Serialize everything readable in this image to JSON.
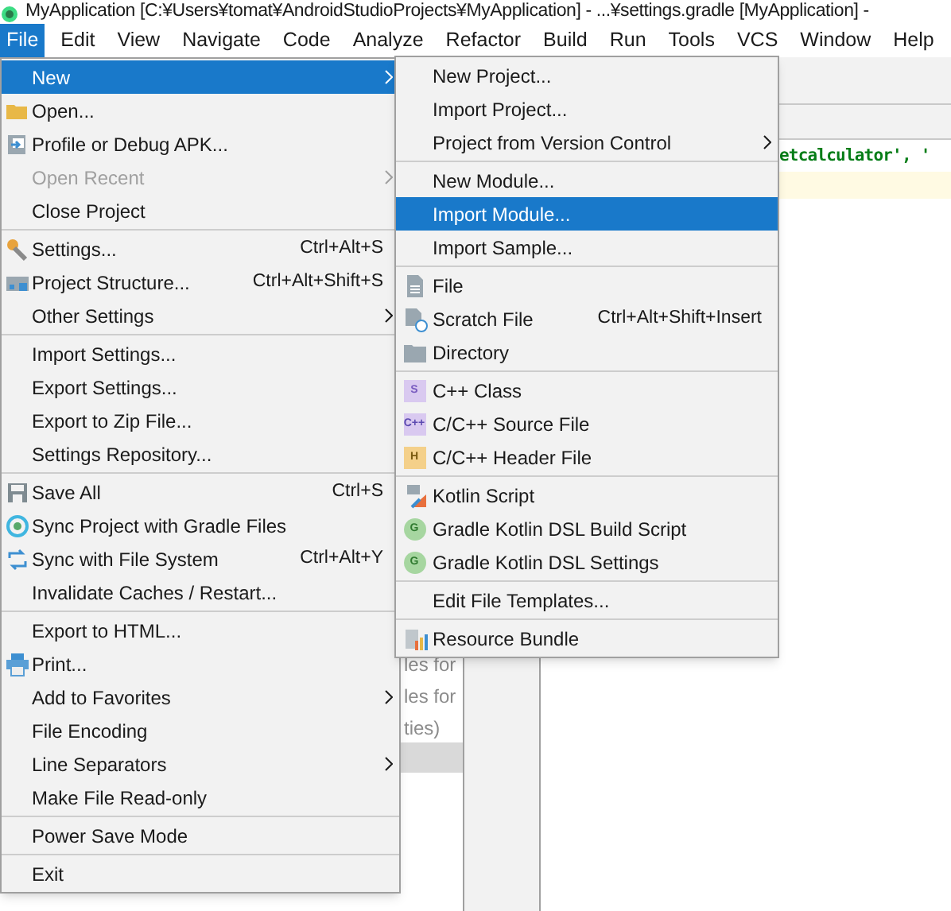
{
  "window": {
    "title": "MyApplication [C:¥Users¥tomat¥AndroidStudioProjects¥MyApplication] - ...¥settings.gradle [MyApplication] -"
  },
  "menu_bar": [
    {
      "label": "File",
      "selected": true
    },
    {
      "label": "Edit",
      "selected": false
    },
    {
      "label": "View",
      "selected": false
    },
    {
      "label": "Navigate",
      "selected": false
    },
    {
      "label": "Code",
      "selected": false
    },
    {
      "label": "Analyze",
      "selected": false
    },
    {
      "label": "Refactor",
      "selected": false
    },
    {
      "label": "Build",
      "selected": false
    },
    {
      "label": "Run",
      "selected": false
    },
    {
      "label": "Tools",
      "selected": false
    },
    {
      "label": "VCS",
      "selected": false
    },
    {
      "label": "Window",
      "selected": false
    },
    {
      "label": "Help",
      "selected": false
    }
  ],
  "editor": {
    "code_line": "etcalculator', '",
    "behind_lines": [
      "les for",
      "les for",
      "ties)"
    ]
  },
  "file_menu": {
    "items": [
      {
        "kind": "item",
        "label": "New",
        "selected": true,
        "disabled": false,
        "submenu": true
      },
      {
        "kind": "item",
        "label": "Open...",
        "selected": false,
        "disabled": false,
        "submenu": false
      },
      {
        "kind": "item",
        "label": "Profile or Debug APK...",
        "selected": false,
        "disabled": false,
        "submenu": false
      },
      {
        "kind": "item",
        "label": "Open Recent",
        "selected": false,
        "disabled": true,
        "submenu": true
      },
      {
        "kind": "item",
        "label": "Close Project",
        "selected": false,
        "disabled": false,
        "submenu": false
      },
      {
        "kind": "separator"
      },
      {
        "kind": "item",
        "label": "Settings...",
        "shortcut": "Ctrl+Alt+S",
        "selected": false,
        "disabled": false,
        "submenu": false
      },
      {
        "kind": "item",
        "label": "Project Structure...",
        "shortcut": "Ctrl+Alt+Shift+S",
        "selected": false,
        "disabled": false,
        "submenu": false
      },
      {
        "kind": "item",
        "label": "Other Settings",
        "selected": false,
        "disabled": false,
        "submenu": true
      },
      {
        "kind": "separator"
      },
      {
        "kind": "item",
        "label": "Import Settings...",
        "selected": false,
        "disabled": false,
        "submenu": false
      },
      {
        "kind": "item",
        "label": "Export Settings...",
        "selected": false,
        "disabled": false,
        "submenu": false
      },
      {
        "kind": "item",
        "label": "Export to Zip File...",
        "selected": false,
        "disabled": false,
        "submenu": false
      },
      {
        "kind": "item",
        "label": "Settings Repository...",
        "selected": false,
        "disabled": false,
        "submenu": false
      },
      {
        "kind": "separator"
      },
      {
        "kind": "item",
        "label": "Save All",
        "shortcut": "Ctrl+S",
        "selected": false,
        "disabled": false,
        "submenu": false
      },
      {
        "kind": "item",
        "label": "Sync Project with Gradle Files",
        "selected": false,
        "disabled": false,
        "submenu": false
      },
      {
        "kind": "item",
        "label": "Sync with File System",
        "shortcut": "Ctrl+Alt+Y",
        "selected": false,
        "disabled": false,
        "submenu": false
      },
      {
        "kind": "item",
        "label": "Invalidate Caches / Restart...",
        "selected": false,
        "disabled": false,
        "submenu": false
      },
      {
        "kind": "separator"
      },
      {
        "kind": "item",
        "label": "Export to HTML...",
        "selected": false,
        "disabled": false,
        "submenu": false
      },
      {
        "kind": "item",
        "label": "Print...",
        "selected": false,
        "disabled": false,
        "submenu": false
      },
      {
        "kind": "item",
        "label": "Add to Favorites",
        "selected": false,
        "disabled": false,
        "submenu": true
      },
      {
        "kind": "item",
        "label": "File Encoding",
        "selected": false,
        "disabled": false,
        "submenu": false
      },
      {
        "kind": "item",
        "label": "Line Separators",
        "selected": false,
        "disabled": false,
        "submenu": true
      },
      {
        "kind": "item",
        "label": "Make File Read-only",
        "selected": false,
        "disabled": false,
        "submenu": false
      },
      {
        "kind": "separator"
      },
      {
        "kind": "item",
        "label": "Power Save Mode",
        "selected": false,
        "disabled": false,
        "submenu": false
      },
      {
        "kind": "separator"
      },
      {
        "kind": "item",
        "label": "Exit",
        "selected": false,
        "disabled": false,
        "submenu": false
      }
    ]
  },
  "new_submenu": {
    "items": [
      {
        "kind": "item",
        "label": "New Project...",
        "selected": false,
        "disabled": false,
        "submenu": false
      },
      {
        "kind": "item",
        "label": "Import Project...",
        "selected": false,
        "disabled": false,
        "submenu": false
      },
      {
        "kind": "item",
        "label": "Project from Version Control",
        "selected": false,
        "disabled": false,
        "submenu": true
      },
      {
        "kind": "separator"
      },
      {
        "kind": "item",
        "label": "New Module...",
        "selected": false,
        "disabled": false,
        "submenu": false
      },
      {
        "kind": "item",
        "label": "Import Module...",
        "selected": true,
        "disabled": false,
        "submenu": false
      },
      {
        "kind": "item",
        "label": "Import Sample...",
        "selected": false,
        "disabled": false,
        "submenu": false
      },
      {
        "kind": "separator"
      },
      {
        "kind": "item",
        "label": "File",
        "selected": false,
        "disabled": false,
        "submenu": false
      },
      {
        "kind": "item",
        "label": "Scratch File",
        "shortcut": "Ctrl+Alt+Shift+Insert",
        "selected": false,
        "disabled": false,
        "submenu": false
      },
      {
        "kind": "item",
        "label": "Directory",
        "selected": false,
        "disabled": false,
        "submenu": false
      },
      {
        "kind": "separator"
      },
      {
        "kind": "item",
        "label": "C++ Class",
        "icon_text": "S",
        "selected": false,
        "disabled": false,
        "submenu": false
      },
      {
        "kind": "item",
        "label": "C/C++ Source File",
        "icon_text": "C++",
        "selected": false,
        "disabled": false,
        "submenu": false
      },
      {
        "kind": "item",
        "label": "C/C++ Header File",
        "icon_text": "H",
        "selected": false,
        "disabled": false,
        "submenu": false
      },
      {
        "kind": "separator"
      },
      {
        "kind": "item",
        "label": "Kotlin Script",
        "selected": false,
        "disabled": false,
        "submenu": false
      },
      {
        "kind": "item",
        "label": "Gradle Kotlin DSL Build Script",
        "icon_text": "G",
        "selected": false,
        "disabled": false,
        "submenu": false
      },
      {
        "kind": "item",
        "label": "Gradle Kotlin DSL Settings",
        "icon_text": "G",
        "selected": false,
        "disabled": false,
        "submenu": false
      },
      {
        "kind": "separator"
      },
      {
        "kind": "item",
        "label": "Edit File Templates...",
        "selected": false,
        "disabled": false,
        "submenu": false
      },
      {
        "kind": "separator"
      },
      {
        "kind": "item",
        "label": "Resource Bundle",
        "selected": false,
        "disabled": false,
        "submenu": false
      }
    ]
  }
}
